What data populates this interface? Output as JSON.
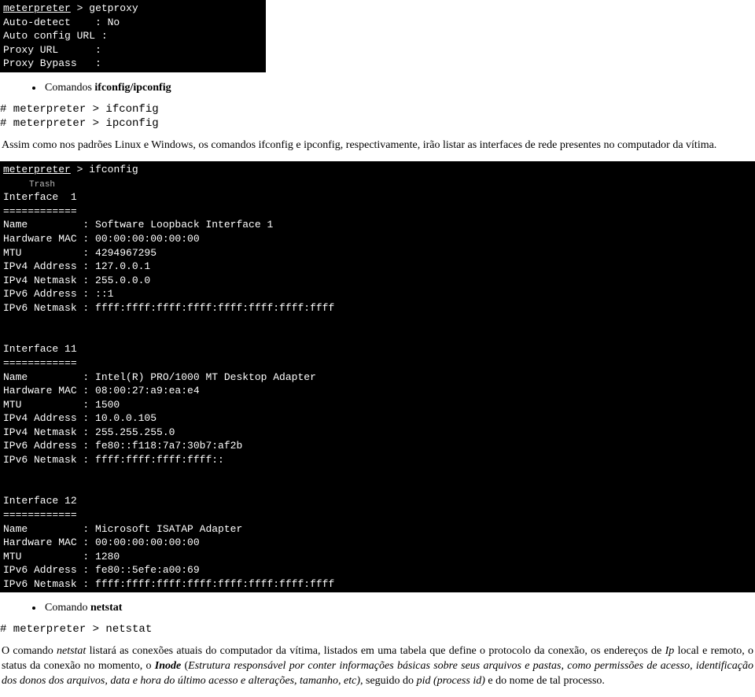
{
  "term1": {
    "prompt": "meterpreter",
    "gt": ">",
    "cmd": "getproxy",
    "lines": [
      "Auto-detect    : No",
      "Auto config URL :",
      "Proxy URL      :",
      "Proxy Bypass   :"
    ]
  },
  "bulletA": {
    "prefix": "Comandos ",
    "bold": "ifconfig/ipconfig"
  },
  "blockA": {
    "l1": "# meterpreter > ifconfig",
    "l2": "# meterpreter > ipconfig"
  },
  "paraA": "Assim como nos padrões Linux e Windows, os comandos ifconfig e ipconfig, respectivamente, irão listar as interfaces de rede presentes no computador da vítima.",
  "term2": {
    "prompt": "meterpreter",
    "gt": ">",
    "cmd": "ifconfig",
    "trash": "Trash",
    "if1": {
      "header": "Interface  1",
      "sep": "============",
      "rows": [
        "Name         : Software Loopback Interface 1",
        "Hardware MAC : 00:00:00:00:00:00",
        "MTU          : 4294967295",
        "IPv4 Address : 127.0.0.1",
        "IPv4 Netmask : 255.0.0.0",
        "IPv6 Address : ::1",
        "IPv6 Netmask : ffff:ffff:ffff:ffff:ffff:ffff:ffff:ffff"
      ]
    },
    "if2": {
      "header": "Interface 11",
      "sep": "============",
      "rows": [
        "Name         : Intel(R) PRO/1000 MT Desktop Adapter",
        "Hardware MAC : 08:00:27:a9:ea:e4",
        "MTU          : 1500",
        "IPv4 Address : 10.0.0.105",
        "IPv4 Netmask : 255.255.255.0",
        "IPv6 Address : fe80::f118:7a7:30b7:af2b",
        "IPv6 Netmask : ffff:ffff:ffff:ffff::"
      ]
    },
    "if3": {
      "header": "Interface 12",
      "sep": "============",
      "rows": [
        "Name         : Microsoft ISATAP Adapter",
        "Hardware MAC : 00:00:00:00:00:00",
        "MTU          : 1280",
        "IPv6 Address : fe80::5efe:a00:69",
        "IPv6 Netmask : ffff:ffff:ffff:ffff:ffff:ffff:ffff:ffff"
      ]
    }
  },
  "bulletB": {
    "prefix": "Comando ",
    "bold": "netstat"
  },
  "blockB": {
    "l1": "# meterpreter > netstat"
  },
  "paraB": {
    "p1": "O comando ",
    "i1": "netstat",
    "p2": " listará as conexões atuais do computador da vítima, listados em uma tabela que define o protocolo da conexão, os endereços de ",
    "i2": "Ip",
    "p3": " local e remoto, o status da conexão no momento, o ",
    "bi1": "Inode",
    "p4": " (",
    "i3": "Estrutura  responsável por conter informações básicas sobre seus arquivos e pastas, como permissões de acesso, identificação dos donos dos arquivos, data e hora do último acesso e alterações, tamanho, etc)",
    "p5": ", seguido do ",
    "i4": "pid (process id)",
    "p6": " e do nome de tal processo."
  }
}
